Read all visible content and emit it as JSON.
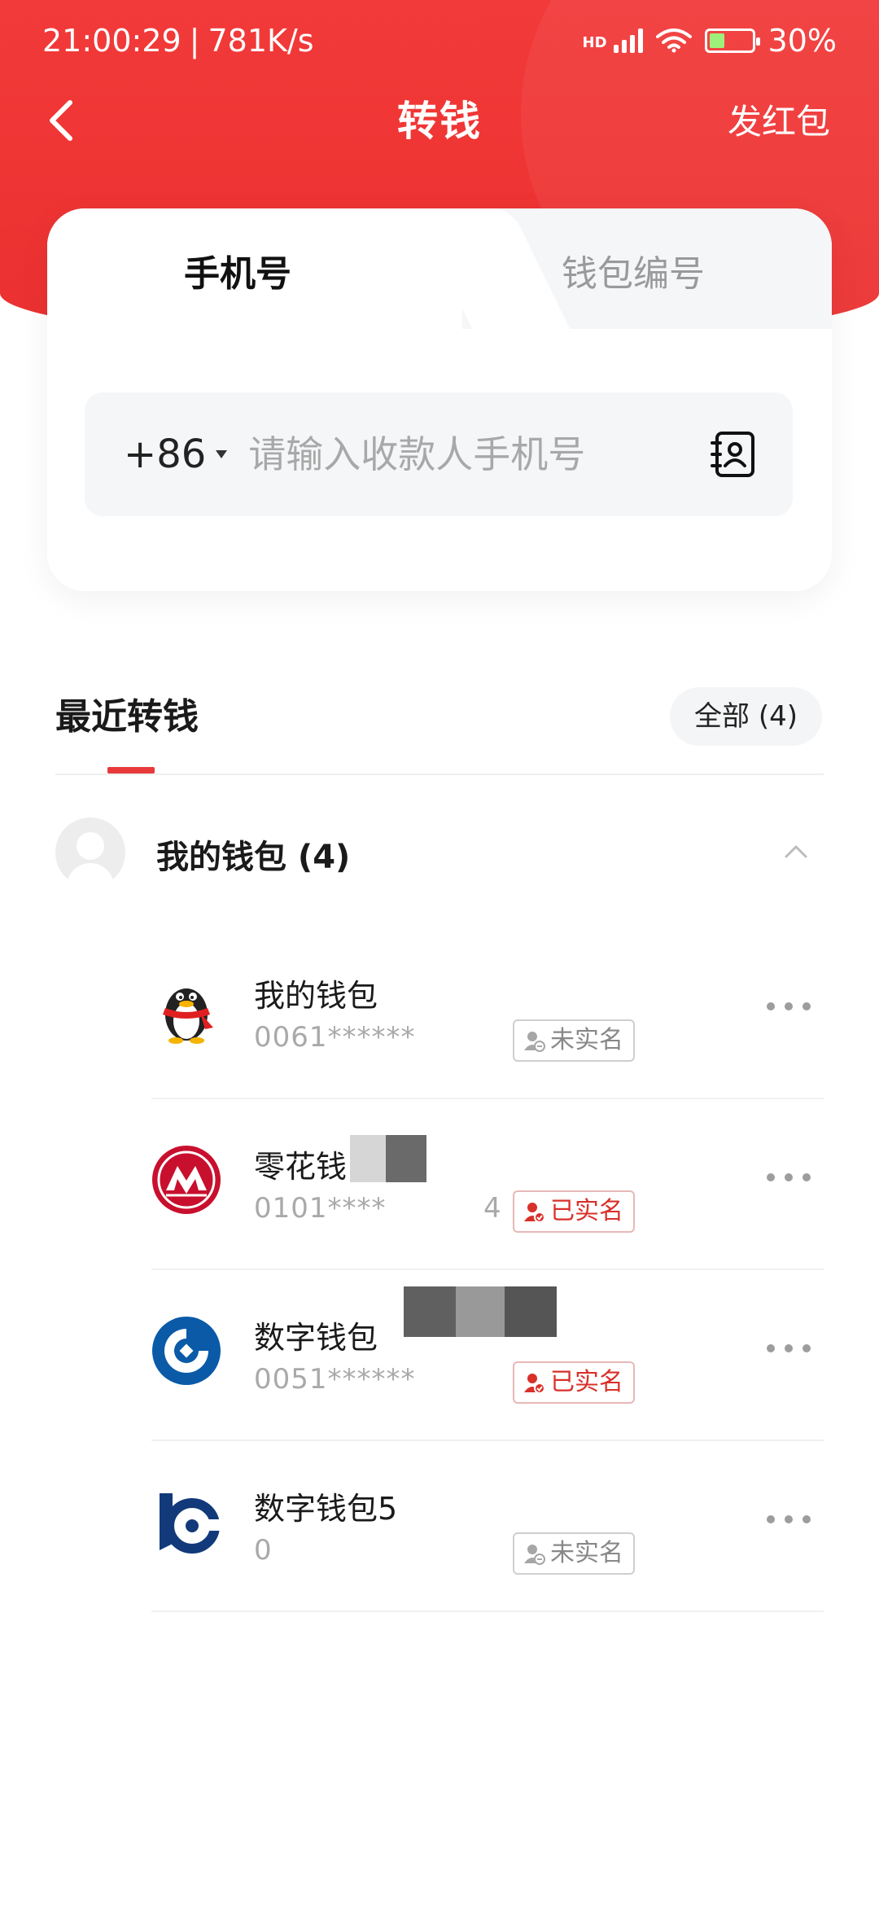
{
  "status_bar": {
    "time": "21:00:29",
    "speed": "781K/s",
    "network_label": "HD",
    "battery": "30%"
  },
  "nav": {
    "title": "转钱",
    "action": "发红包"
  },
  "tabs": {
    "phone": "手机号",
    "wallet_id": "钱包编号"
  },
  "phone_input": {
    "country_code": "+86",
    "placeholder": "请输入收款人手机号"
  },
  "recent": {
    "title": "最近转钱",
    "all_button": "全部 (4)"
  },
  "group": {
    "label": "我的钱包 (4)"
  },
  "wallets": [
    {
      "name": "我的钱包",
      "number": "0061******",
      "badge": "未实名",
      "verified": false
    },
    {
      "name": "零花钱",
      "number": "0101****",
      "number_tail": "4",
      "badge": "已实名",
      "verified": true
    },
    {
      "name": "数字钱包",
      "number": "0051******",
      "badge": "已实名",
      "verified": true
    },
    {
      "name": "数字钱包5",
      "number": "0",
      "badge": "未实名",
      "verified": false
    }
  ],
  "colors": {
    "brand_red": "#ee3433",
    "verified_red": "#d9302a"
  }
}
